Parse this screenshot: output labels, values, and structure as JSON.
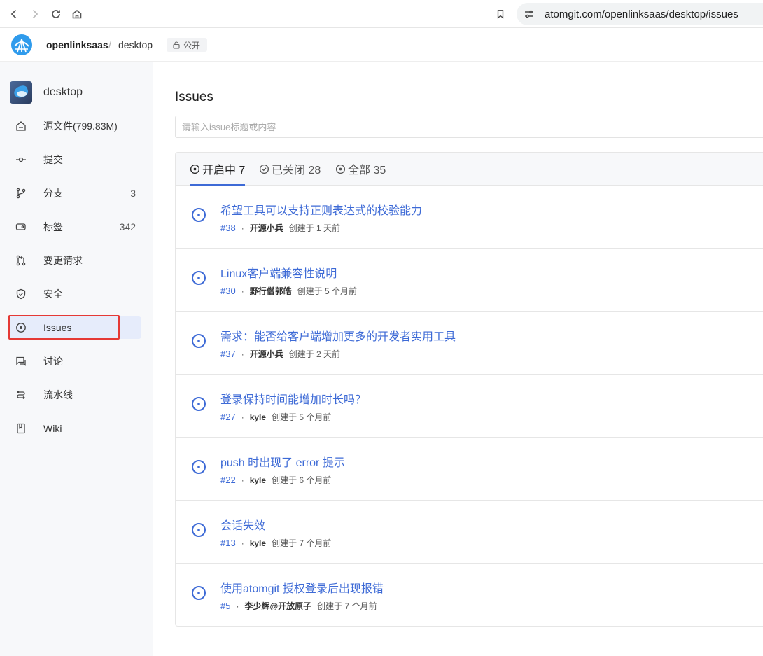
{
  "browser": {
    "url": "atomgit.com/openlinksaas/desktop/issues"
  },
  "repo_header": {
    "owner": "openlinksaas",
    "separator": "/",
    "repo": "desktop",
    "visibility": "公开"
  },
  "sidebar": {
    "repo_name": "desktop",
    "items": [
      {
        "label": "源文件(799.83M)",
        "count": "",
        "icon": "home-file-icon"
      },
      {
        "label": "提交",
        "count": "",
        "icon": "commit-icon"
      },
      {
        "label": "分支",
        "count": "3",
        "icon": "branch-icon"
      },
      {
        "label": "标签",
        "count": "342",
        "icon": "tag-icon"
      },
      {
        "label": "变更请求",
        "count": "",
        "icon": "pull-request-icon"
      },
      {
        "label": "安全",
        "count": "",
        "icon": "shield-icon"
      },
      {
        "label": "Issues",
        "count": "",
        "icon": "issue-icon"
      },
      {
        "label": "讨论",
        "count": "",
        "icon": "discussion-icon"
      },
      {
        "label": "流水线",
        "count": "",
        "icon": "pipeline-icon"
      },
      {
        "label": "Wiki",
        "count": "",
        "icon": "book-icon"
      }
    ],
    "active_index": 6
  },
  "main": {
    "title": "Issues",
    "search_placeholder": "请输入issue标题或内容",
    "tabs": [
      {
        "label": "开启中 7"
      },
      {
        "label": "已关闭 28"
      },
      {
        "label": "全部 35"
      }
    ],
    "meta_separator": "·",
    "issues": [
      {
        "title": "希望工具可以支持正则表达式的校验能力",
        "number": "#38",
        "author": "开源小兵",
        "created": "创建于 1 天前"
      },
      {
        "title": "Linux客户端兼容性说明",
        "number": "#30",
        "author": "野行僧郭皓",
        "created": "创建于 5 个月前"
      },
      {
        "title": "需求：能否给客户端增加更多的开发者实用工具",
        "number": "#37",
        "author": "开源小兵",
        "created": "创建于 2 天前"
      },
      {
        "title": "登录保持时间能增加时长吗？",
        "number": "#27",
        "author": "kyle",
        "created": "创建于 5 个月前"
      },
      {
        "title": "push 时出现了 error 提示",
        "number": "#22",
        "author": "kyle",
        "created": "创建于 6 个月前"
      },
      {
        "title": "会话失效",
        "number": "#13",
        "author": "kyle",
        "created": "创建于 7 个月前"
      },
      {
        "title": "使用atomgit 授权登录后出现报错",
        "number": "#5",
        "author": "李少辉@开放原子",
        "created": "创建于 7 个月前"
      }
    ]
  },
  "colors": {
    "accent": "#3d6ad6",
    "active_bg": "#e6ecfb",
    "highlight": "#e53935"
  }
}
